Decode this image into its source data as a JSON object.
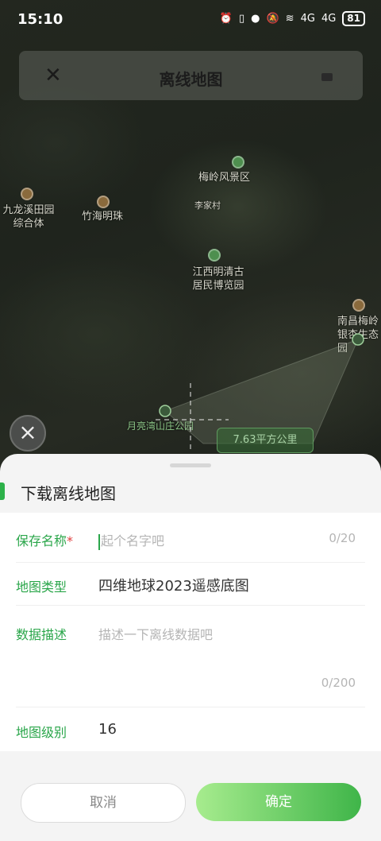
{
  "status_bar": {
    "time": "15:10",
    "icons": [
      "alarm-icon",
      "vibrate-icon",
      "location-icon",
      "mute-icon",
      "wifi-icon",
      "signal-4g-icon",
      "signal-4g-icon"
    ],
    "battery": "81",
    "net_label_1": "4G",
    "net_label_2": "4G"
  },
  "header": {
    "title": "离线地图",
    "close_icon": "close-icon",
    "menu_icon": "menu-icon"
  },
  "map": {
    "labels": [
      {
        "text": "九龙溪田园\n综合体"
      },
      {
        "text": "竹海明珠"
      },
      {
        "text": "梅岭风景区"
      },
      {
        "text": "李家村"
      },
      {
        "text": "江西明清古\n居民博览园"
      },
      {
        "text": "南昌梅岭\n银杏生态园"
      },
      {
        "text": "月亮湾山庄公园"
      }
    ],
    "area_badge": "7.63平方公里"
  },
  "sheet": {
    "title": "下载离线地图",
    "fields": {
      "save_name": {
        "label": "保存名称",
        "required_mark": "*",
        "placeholder": "起个名字吧",
        "counter": "0/20"
      },
      "map_type": {
        "label": "地图类型",
        "value": "四维地球2023遥感底图"
      },
      "description": {
        "label": "数据描述",
        "placeholder": "描述一下离线数据吧",
        "counter": "0/200"
      },
      "map_level": {
        "label": "地图级别",
        "value": "16"
      }
    },
    "cancel_label": "取消",
    "confirm_label": "确定"
  },
  "colors": {
    "accent": "#2db14a",
    "confirm_start": "#a7ec8e",
    "confirm_end": "#3fb549"
  }
}
